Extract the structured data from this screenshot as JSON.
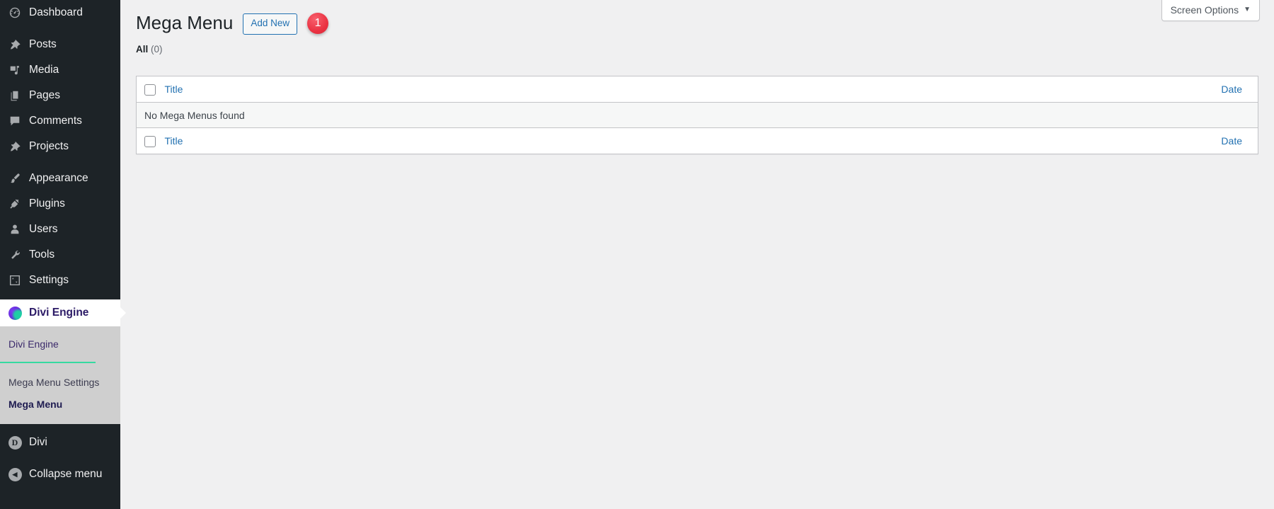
{
  "sidebar": {
    "items": [
      {
        "label": "Dashboard",
        "icon": "dashboard-icon",
        "name": "sidebar-item-dashboard"
      },
      {
        "label": "Posts",
        "icon": "pin-icon",
        "name": "sidebar-item-posts"
      },
      {
        "label": "Media",
        "icon": "media-icon",
        "name": "sidebar-item-media"
      },
      {
        "label": "Pages",
        "icon": "pages-icon",
        "name": "sidebar-item-pages"
      },
      {
        "label": "Comments",
        "icon": "comment-icon",
        "name": "sidebar-item-comments"
      },
      {
        "label": "Projects",
        "icon": "pin-icon",
        "name": "sidebar-item-projects"
      },
      {
        "label": "Appearance",
        "icon": "brush-icon",
        "name": "sidebar-item-appearance"
      },
      {
        "label": "Plugins",
        "icon": "plug-icon",
        "name": "sidebar-item-plugins"
      },
      {
        "label": "Users",
        "icon": "user-icon",
        "name": "sidebar-item-users"
      },
      {
        "label": "Tools",
        "icon": "wrench-icon",
        "name": "sidebar-item-tools"
      },
      {
        "label": "Settings",
        "icon": "sliders-icon",
        "name": "sidebar-item-settings"
      }
    ],
    "current_item": {
      "label": "Divi Engine",
      "icon": "divi-engine-blob-icon"
    },
    "submenu": {
      "heading": "Divi Engine",
      "items": [
        {
          "label": "Mega Menu Settings",
          "current": false
        },
        {
          "label": "Mega Menu",
          "current": true
        }
      ]
    },
    "bottom_items": [
      {
        "label": "Divi",
        "icon": "divi-circle-d-icon",
        "glyph": "D"
      },
      {
        "label": "Collapse menu",
        "icon": "collapse-arrow-icon",
        "glyph": "◀"
      }
    ],
    "colors": {
      "background": "#1d2327",
      "submenu_background": "#cfcfcf",
      "divider_green": "#36d9a0",
      "active_text": "#1e1b50"
    }
  },
  "screen_meta": {
    "screen_options_label": "Screen Options",
    "caret": "▼"
  },
  "page": {
    "title": "Mega Menu",
    "add_new_label": "Add New",
    "badge": "1",
    "badge_color": "#ef3b4b"
  },
  "filters": {
    "all_label": "All",
    "all_count": "(0)"
  },
  "table": {
    "columns": {
      "title": "Title",
      "date": "Date"
    },
    "empty_message": "No Mega Menus found"
  }
}
